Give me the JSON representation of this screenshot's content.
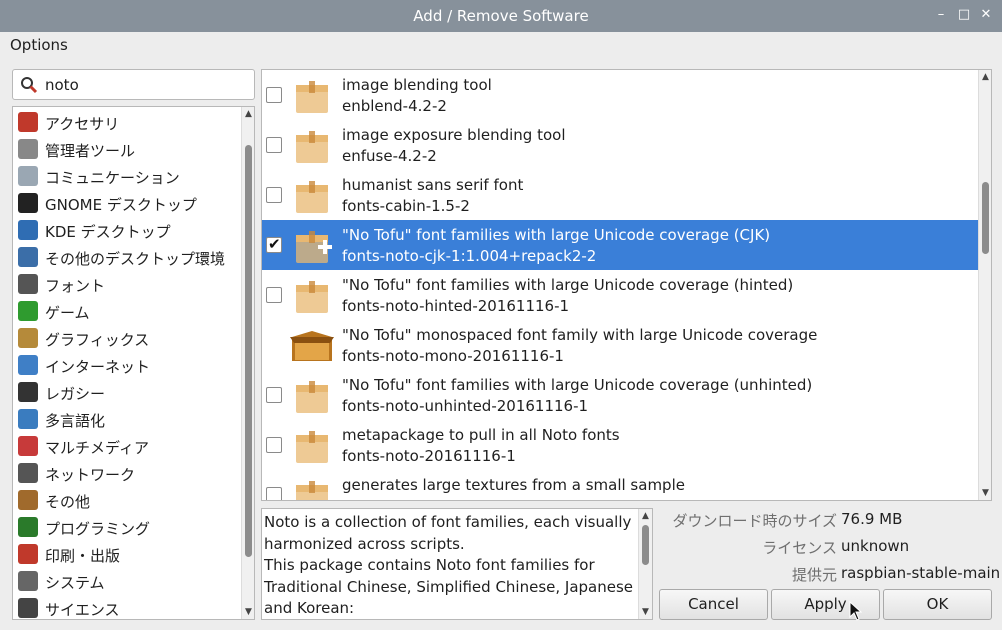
{
  "window": {
    "title": "Add / Remove Software"
  },
  "menu": {
    "options": "Options"
  },
  "search": {
    "value": "noto"
  },
  "categories": [
    {
      "label": "アクセサリ",
      "icon": "accessories-knife-icon",
      "color": "#c0392b"
    },
    {
      "label": "管理者ツール",
      "icon": "admin-monitor-icon",
      "color": "#888888"
    },
    {
      "label": "コミュニケーション",
      "icon": "communication-envelope-icon",
      "color": "#9aa7b3"
    },
    {
      "label": "GNOME デスクトップ",
      "icon": "gnome-foot-icon",
      "color": "#222222"
    },
    {
      "label": "KDE デスクトップ",
      "icon": "kde-gear-icon",
      "color": "#2f6db3"
    },
    {
      "label": "その他のデスクトップ環境",
      "icon": "desktop-environment-icon",
      "color": "#3b6ea8"
    },
    {
      "label": "フォント",
      "icon": "font-icon",
      "color": "#555555"
    },
    {
      "label": "ゲーム",
      "icon": "game-invader-icon",
      "color": "#2f9b2f"
    },
    {
      "label": "グラフィックス",
      "icon": "graphics-brush-icon",
      "color": "#b58a3a"
    },
    {
      "label": "インターネット",
      "icon": "internet-globe-icon",
      "color": "#3f7fc6"
    },
    {
      "label": "レガシー",
      "icon": "legacy-floppy-icon",
      "color": "#333333"
    },
    {
      "label": "多言語化",
      "icon": "localization-flag-icon",
      "color": "#3a7cbf"
    },
    {
      "label": "マルチメディア",
      "icon": "multimedia-popcorn-icon",
      "color": "#c73a3a"
    },
    {
      "label": "ネットワーク",
      "icon": "network-search-icon",
      "color": "#555555"
    },
    {
      "label": "その他",
      "icon": "misc-box-icon",
      "color": "#a06a2c"
    },
    {
      "label": "プログラミング",
      "icon": "programming-braces-icon",
      "color": "#2a7a2a"
    },
    {
      "label": "印刷・出版",
      "icon": "printing-letter-icon",
      "color": "#c0392b"
    },
    {
      "label": "システム",
      "icon": "system-gear-icon",
      "color": "#666666"
    },
    {
      "label": "サイエンス",
      "icon": "science-document-icon",
      "color": "#444444"
    }
  ],
  "packages": [
    {
      "name": "image blending tool",
      "version": "enblend-4.2-2",
      "checked": false,
      "selected": false,
      "installed": false,
      "checkbox": true
    },
    {
      "name": "image exposure blending tool",
      "version": "enfuse-4.2-2",
      "checked": false,
      "selected": false,
      "installed": false,
      "checkbox": true
    },
    {
      "name": "humanist sans serif font",
      "version": "fonts-cabin-1.5-2",
      "checked": false,
      "selected": false,
      "installed": false,
      "checkbox": true
    },
    {
      "name": "\"No Tofu\" font families with large Unicode coverage (CJK)",
      "version": "fonts-noto-cjk-1:1.004+repack2-2",
      "checked": true,
      "selected": true,
      "installed": false,
      "checkbox": true
    },
    {
      "name": "\"No Tofu\" font families with large Unicode coverage (hinted)",
      "version": "fonts-noto-hinted-20161116-1",
      "checked": false,
      "selected": false,
      "installed": false,
      "checkbox": true
    },
    {
      "name": "\"No Tofu\" monospaced font family with large Unicode coverage",
      "version": "fonts-noto-mono-20161116-1",
      "checked": false,
      "selected": false,
      "installed": true,
      "checkbox": false
    },
    {
      "name": "\"No Tofu\" font families with large Unicode coverage (unhinted)",
      "version": "fonts-noto-unhinted-20161116-1",
      "checked": false,
      "selected": false,
      "installed": false,
      "checkbox": true
    },
    {
      "name": "metapackage to pull in all Noto fonts",
      "version": "fonts-noto-20161116-1",
      "checked": false,
      "selected": false,
      "installed": false,
      "checkbox": true
    },
    {
      "name": "generates large textures from a small sample",
      "version": "",
      "checked": false,
      "selected": false,
      "installed": false,
      "checkbox": true
    }
  ],
  "description": "Noto is a collection of font families, each visually harmonized across scripts.\nThis package contains Noto font families for Traditional Chinese, Simplified Chinese, Japanese and Korean:",
  "info": {
    "download_label": "ダウンロード時のサイズ",
    "download_value": "76.9 MB",
    "license_label": "ライセンス",
    "license_value": "unknown",
    "source_label": "提供元",
    "source_value": "raspbian-stable-main"
  },
  "buttons": {
    "cancel": "Cancel",
    "apply": "Apply",
    "ok": "OK"
  },
  "colors": {
    "titlebar": "#87919b",
    "selection": "#3a7fd8",
    "package_box": "#e8b872"
  }
}
